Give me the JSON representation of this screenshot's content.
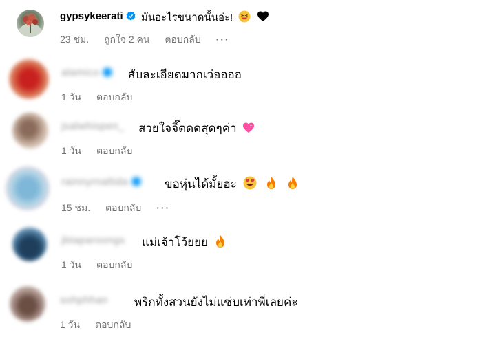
{
  "top_comment": {
    "username": "gypsykeerati",
    "text": "มันอะไรขนาดนั้นอ่ะ!",
    "time": "23 ชม.",
    "likes": "ถูกใจ 2 คน",
    "reply": "ตอบกลับ",
    "emojis": [
      "laughing-face-icon",
      "black-heart-icon"
    ]
  },
  "replies": [
    {
      "username": "alamico",
      "text": "สับละเอียดมากเว่ออออ",
      "time": "1 วัน",
      "reply": "ตอบกลับ"
    },
    {
      "username": "jsalwhispen_",
      "text": "สวยใจจึ๊ดดดสุดๆค่า",
      "time": "1 วัน",
      "reply": "ตอบกลับ"
    },
    {
      "username": "rainnyrnaltida",
      "text": "ขอหุ่นได้มั้ยฮะ",
      "time": "15 ชม.",
      "reply": "ตอบกลับ"
    },
    {
      "username": "jbtaparoongs",
      "text": "แม่เจ้าโว้ยยย",
      "time": "1 วัน",
      "reply": "ตอบกลับ"
    },
    {
      "username": "sohphhan",
      "text": "พริกทั้งสวนยังไม่แซ่บเท่าพี่เลยค่ะ",
      "time": "1 วัน",
      "reply": "ตอบกลับ"
    }
  ],
  "more_glyph": "···",
  "colors": {
    "verified": "#0095f6",
    "meta_text": "#737373",
    "fire": "#f77f00",
    "heart_pink": "#ff4fa3"
  }
}
